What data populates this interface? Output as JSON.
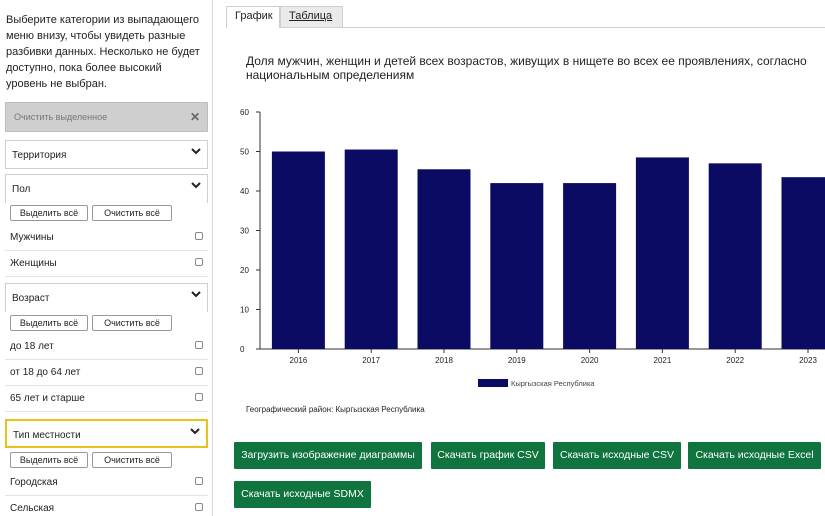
{
  "sidebar": {
    "intro_text": "Выберите категории из выпадающего меню внизу, чтобы увидеть разные разбивки данных. Несколько не будет доступно, пока более высокий уровень не выбран.",
    "clear_selected_label": "Очистить выделенное",
    "select_all_label": "Выделить всё",
    "clear_all_label": "Очистить всё",
    "groups": [
      {
        "label": "Территория"
      },
      {
        "label": "Пол",
        "options": [
          "Мужчины",
          "Женщины"
        ]
      },
      {
        "label": "Возраст",
        "options": [
          "до 18 лет",
          "от 18 до 64 лет",
          "65 лет и старше"
        ]
      },
      {
        "label": "Тип местности",
        "options": [
          "Городская",
          "Сельская"
        ]
      }
    ]
  },
  "tabs": [
    {
      "label": "График",
      "active": true
    },
    {
      "label": "Таблица",
      "active": false
    }
  ],
  "chart_title": "Доля мужчин, женщин и детей всех возрастов, живущих в нищете во всех ее проявлениях, согласно национальным определениям",
  "geo_note": "Географический район: Кыргызская Республика",
  "chart_data": {
    "type": "bar",
    "categories": [
      "2016",
      "2017",
      "2018",
      "2019",
      "2020",
      "2021",
      "2022",
      "2023"
    ],
    "series": [
      {
        "name": "Кыргызская Республика",
        "values": [
          50.0,
          50.5,
          45.5,
          42.0,
          42.0,
          48.5,
          47.0,
          43.5
        ],
        "color": "#0b0b63"
      }
    ],
    "ylim": [
      0,
      60
    ],
    "yticks": [
      "0",
      "10",
      "20",
      "30",
      "40",
      "50",
      "60"
    ],
    "grid": false,
    "legend_position": "bottom"
  },
  "buttons": {
    "download_image": "Загрузить изображение диаграммы",
    "download_chart_csv": "Скачать график CSV",
    "download_source_csv": "Скачать исходные CSV",
    "download_source_excel": "Скачать исходные Excel",
    "download_source_sdmx": "Скачать исходные SDMX"
  },
  "colors": {
    "accent_green": "#10743f",
    "bar": "#0b0b63",
    "active_highlight": "#e8c21a"
  }
}
